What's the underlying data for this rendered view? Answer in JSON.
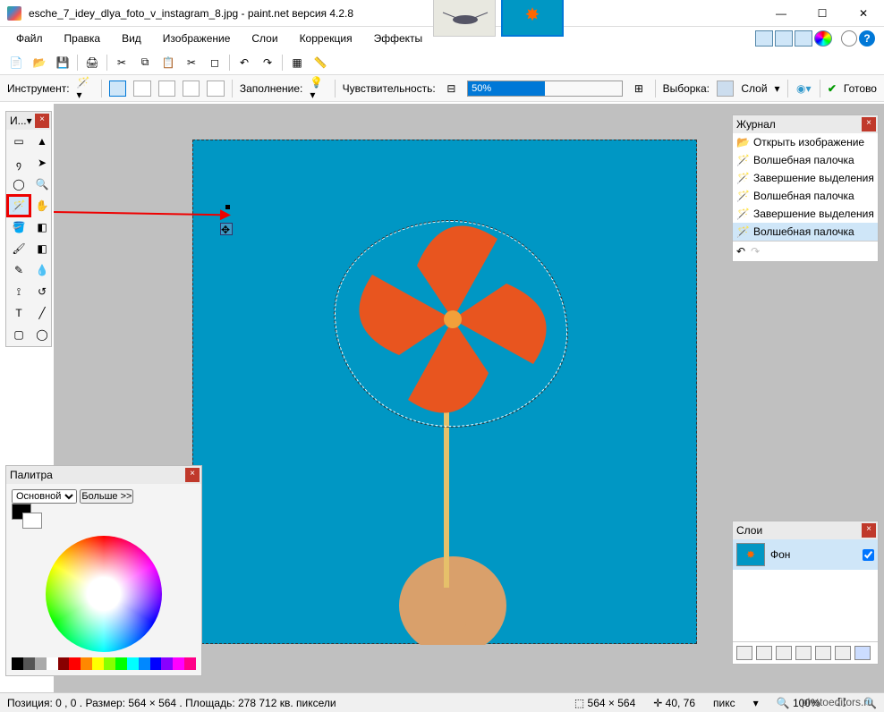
{
  "titlebar": {
    "filename": "esche_7_idey_dlya_foto_v_instagram_8.jpg",
    "appname": "paint.net версия 4.2.8"
  },
  "menu": {
    "file": "Файл",
    "edit": "Правка",
    "view": "Вид",
    "image": "Изображение",
    "layers": "Слои",
    "adjust": "Коррекция",
    "effects": "Эффекты"
  },
  "options": {
    "tool_label": "Инструмент:",
    "fill_label": "Заполнение:",
    "tolerance_label": "Чувствительность:",
    "tolerance_value": "50%",
    "sampling_label": "Выборка:",
    "sampling_value": "Слой",
    "finish_label": "Готово"
  },
  "tools_panel": {
    "title": "И..."
  },
  "history_panel": {
    "title": "Журнал",
    "items": [
      "Открыть изображение",
      "Волшебная палочка",
      "Завершение выделения палочкой",
      "Волшебная палочка",
      "Завершение выделения палочкой",
      "Волшебная палочка"
    ]
  },
  "layers_panel": {
    "title": "Слои",
    "layer_name": "Фон"
  },
  "palette_panel": {
    "title": "Палитра",
    "primary_label": "Основной",
    "more_label": "Больше >>"
  },
  "statusbar": {
    "position": "Позиция: 0 , 0 . Размер: 564  × 564 . Площадь: 278 712 кв. пиксели",
    "canvas_size": "564 × 564",
    "cursor": "40, 76",
    "units": "пикс",
    "zoom": "100%"
  },
  "watermark": "photoeditors.ru",
  "colors": {
    "accent": "#0078d7",
    "canvas_bg": "#0097c4",
    "workspace_bg": "#c0c0c0",
    "highlight_red": "#e00"
  }
}
